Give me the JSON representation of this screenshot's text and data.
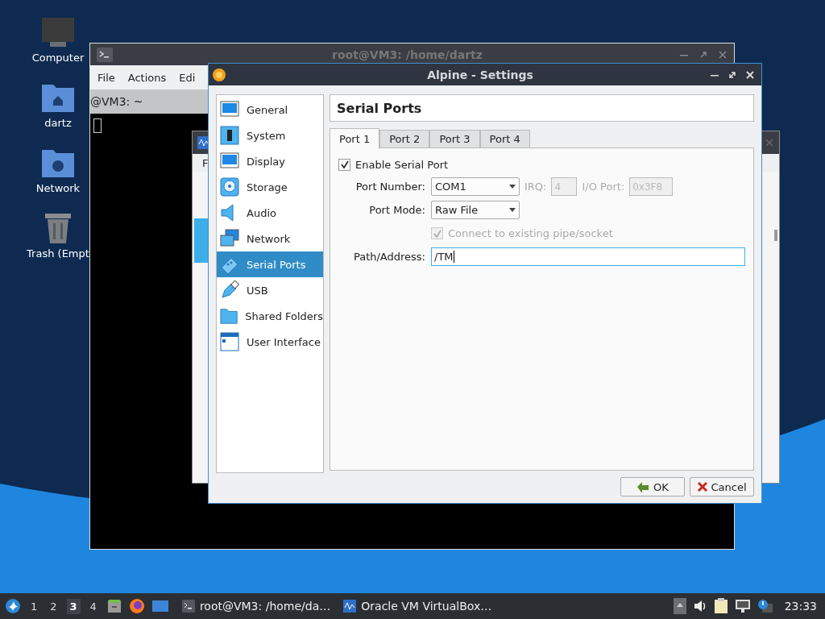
{
  "desktop": {
    "icons": [
      {
        "kind": "computer",
        "label": "Computer"
      },
      {
        "kind": "home",
        "label": "dartz"
      },
      {
        "kind": "network",
        "label": "Network"
      },
      {
        "kind": "trash",
        "label": "Trash (Empt"
      }
    ]
  },
  "terminal": {
    "title": "root@VM3: /home/dartz",
    "menu": [
      "File",
      "Actions",
      "Edi"
    ],
    "tab": "@VM3: ~"
  },
  "virtualbox": {
    "menu": [
      "F"
    ]
  },
  "dialog": {
    "title": "Alpine - Settings",
    "sections": [
      {
        "kind": "general",
        "label": "General",
        "selected": false
      },
      {
        "kind": "system",
        "label": "System",
        "selected": false
      },
      {
        "kind": "display",
        "label": "Display",
        "selected": false
      },
      {
        "kind": "storage",
        "label": "Storage",
        "selected": false
      },
      {
        "kind": "audio",
        "label": "Audio",
        "selected": false
      },
      {
        "kind": "network",
        "label": "Network",
        "selected": false
      },
      {
        "kind": "serial",
        "label": "Serial Ports",
        "selected": true
      },
      {
        "kind": "usb",
        "label": "USB",
        "selected": false
      },
      {
        "kind": "shared",
        "label": "Shared Folders",
        "selected": false
      },
      {
        "kind": "ui",
        "label": "User Interface",
        "selected": false
      }
    ],
    "page_title": "Serial Ports",
    "tabs": [
      {
        "label": "Port 1",
        "selected": true
      },
      {
        "label": "Port 2",
        "selected": false
      },
      {
        "label": "Port 3",
        "selected": false
      },
      {
        "label": "Port 4",
        "selected": false
      }
    ],
    "enable": {
      "label": "Enable Serial Port",
      "checked": true
    },
    "port_number": {
      "label": "Port Number:",
      "value": "COM1"
    },
    "irq": {
      "label": "IRQ:",
      "value": "4",
      "disabled": true
    },
    "io_port": {
      "label": "I/O Port:",
      "value": "0x3F8",
      "disabled": true
    },
    "port_mode": {
      "label": "Port Mode:",
      "value": "Raw File"
    },
    "connect": {
      "label": "Connect to existing pipe/socket",
      "checked": true,
      "disabled": true
    },
    "path": {
      "label": "Path/Address:",
      "value": "/TM"
    },
    "buttons": [
      {
        "kind": "ok",
        "label": "OK"
      },
      {
        "kind": "cancel",
        "label": "Cancel"
      }
    ]
  },
  "taskbar": {
    "workspaces": [
      {
        "label": "1",
        "selected": false
      },
      {
        "label": "2",
        "selected": false
      },
      {
        "label": "3",
        "selected": true
      },
      {
        "label": "4",
        "selected": false
      }
    ],
    "tasks": [
      {
        "kind": "terminal",
        "label": "root@VM3: /home/da…"
      },
      {
        "kind": "virtualbox",
        "label": "Oracle VM VirtualBox…"
      }
    ],
    "clock": "23:33"
  }
}
